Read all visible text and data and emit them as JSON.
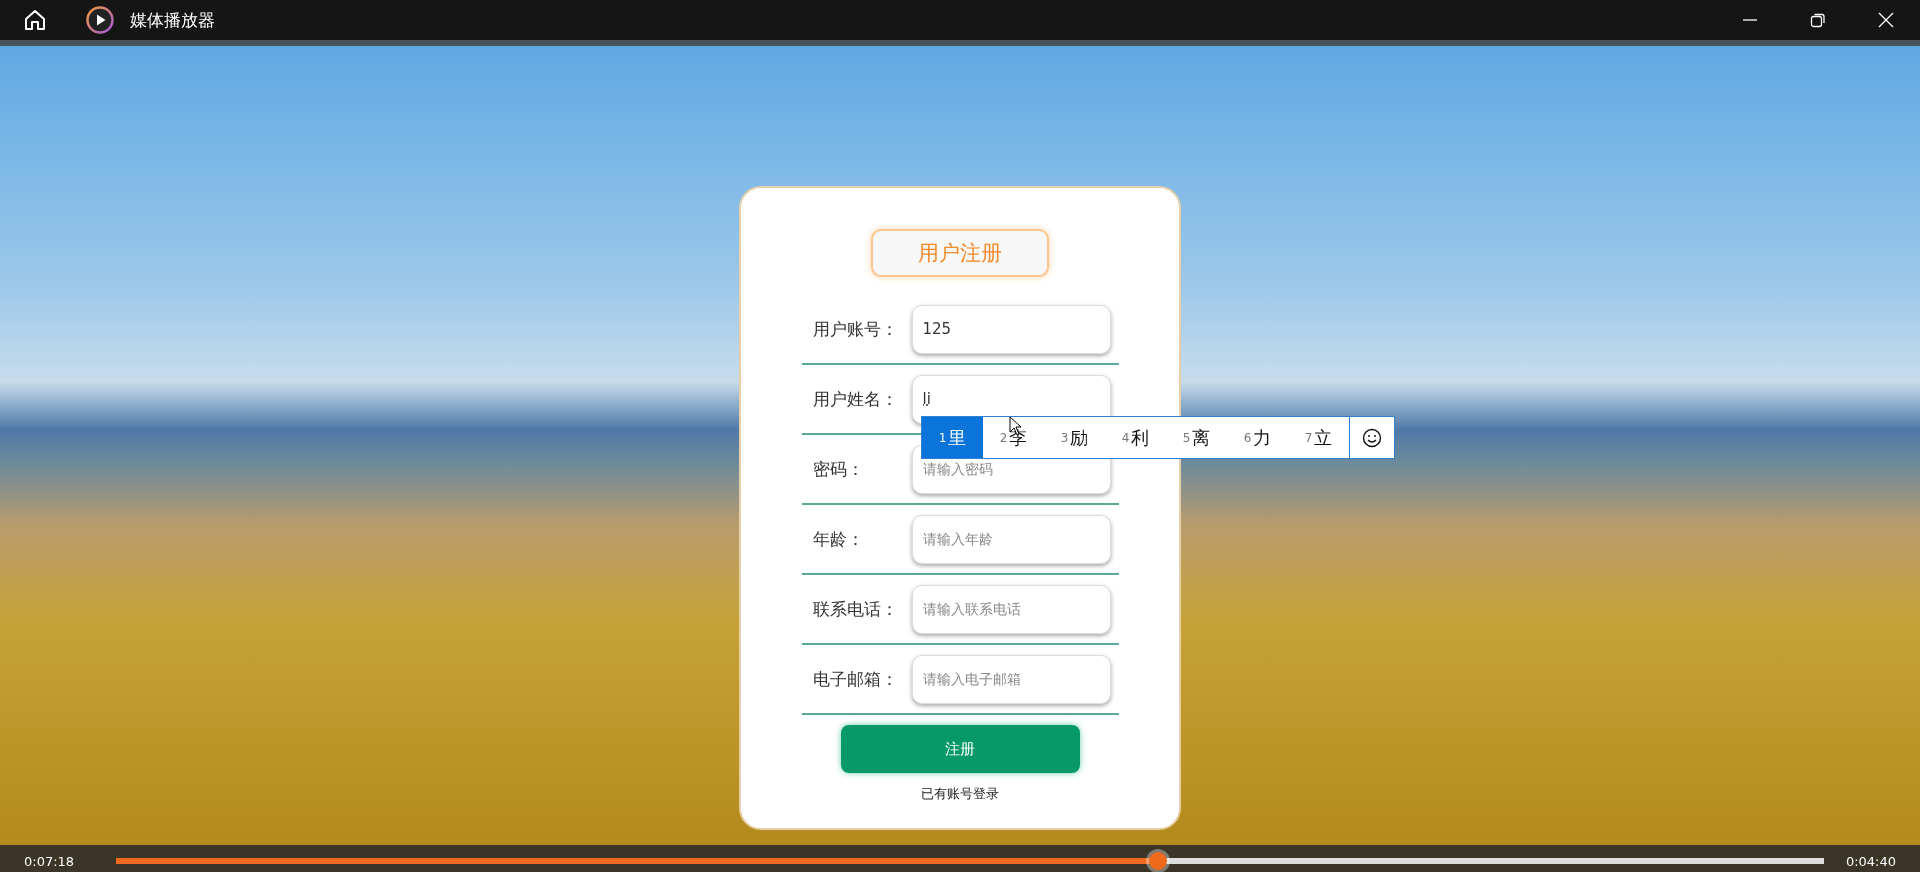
{
  "window": {
    "title": "媒体播放器"
  },
  "form": {
    "title": "用户注册",
    "fields": [
      {
        "label": "用户账号：",
        "value": "125"
      },
      {
        "label": "用户姓名：",
        "value": "li"
      },
      {
        "label": "密码：",
        "placeholder": "请输入密码"
      },
      {
        "label": "年龄：",
        "placeholder": "请输入年龄"
      },
      {
        "label": "联系电话：",
        "placeholder": "请输入联系电话"
      },
      {
        "label": "电子邮箱：",
        "placeholder": "请输入电子邮箱"
      }
    ],
    "submit": "注册",
    "login_link": "已有账号登录"
  },
  "ime": {
    "candidates": [
      {
        "index": "1",
        "text": "里",
        "selected": true
      },
      {
        "index": "2",
        "text": "李",
        "selected": false
      },
      {
        "index": "3",
        "text": "励",
        "selected": false
      },
      {
        "index": "4",
        "text": "利",
        "selected": false
      },
      {
        "index": "5",
        "text": "离",
        "selected": false
      },
      {
        "index": "6",
        "text": "力",
        "selected": false
      },
      {
        "index": "7",
        "text": "立",
        "selected": false
      }
    ]
  },
  "player": {
    "elapsed": "0:07:18",
    "remaining": "0:04:40",
    "level": 0.61
  }
}
